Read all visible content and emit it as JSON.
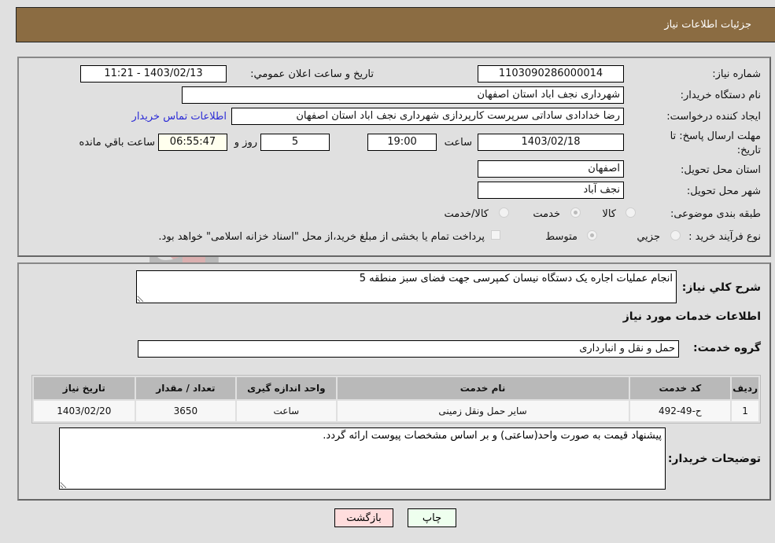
{
  "header": {
    "title": "جزئیات اطلاعات نیاز"
  },
  "form": {
    "need_number": {
      "label": "شماره نیاز:",
      "value": "1103090286000014"
    },
    "announce_datetime": {
      "label": "تاریخ و ساعت اعلان عمومي:",
      "value": "1403/02/13 - 11:21"
    },
    "buyer_org": {
      "label": "نام دستگاه خریدار:",
      "value": "شهرداری نجف اباد استان اصفهان"
    },
    "requester": {
      "label": "ایجاد کننده درخواست:",
      "value": "رضا خدادادی ساداتی سرپرست  کارپردازی شهرداری نجف اباد استان اصفهان"
    },
    "buyer_contact_link": "اطلاعات تماس خریدار",
    "deadline": {
      "label_line1": "مهلت ارسال پاسخ: تا",
      "label_line2": "تاریخ:",
      "date": "1403/02/18",
      "time_label": "ساعت",
      "time": "19:00",
      "days": "5",
      "days_label": "روز و",
      "remaining": "06:55:47",
      "remaining_label": "ساعت باقي مانده"
    },
    "delivery_province": {
      "label": "استان محل تحویل:",
      "value": "اصفهان"
    },
    "delivery_city": {
      "label": "شهر محل تحویل:",
      "value": "نجف آباد"
    },
    "category": {
      "label": "طبقه بندی موضوعی:",
      "options": [
        "کالا",
        "خدمت",
        "کالا/خدمت"
      ],
      "selected": "خدمت"
    },
    "purchase_process": {
      "label": "نوع فرآیند خرید :",
      "options": [
        "جزیي",
        "متوسط"
      ],
      "selected": "متوسط",
      "treasury_note": "پرداخت تمام یا بخشی از مبلغ خرید،از محل \"اسناد خزانه اسلامی\" خواهد بود.",
      "treasury_checked": false
    }
  },
  "details": {
    "summary_label": "شرح كلي نياز:",
    "summary_value": "انجام عملیات اجاره یک دستگاه نیسان کمپرسی جهت فضای سبز منطقه 5",
    "services_heading": "اطلاعات خدمات مورد نياز",
    "service_group_label": "گروه خدمت:",
    "service_group_value": "حمل و نقل و انبارداری",
    "table": {
      "headers": [
        "ردیف",
        "کد خدمت",
        "نام خدمت",
        "واحد اندازه گیری",
        "تعداد / مقدار",
        "تاریخ نیاز"
      ],
      "rows": [
        [
          "1",
          "ح-49-492",
          "سایر حمل ونقل زمینی",
          "ساعت",
          "3650",
          "1403/02/20"
        ]
      ]
    },
    "buyer_notes_label": "توضیحات خریدار:",
    "buyer_notes_value": "پیشنهاد قیمت به صورت واحد(ساعتی) و بر اساس مشخصات پیوست ارائه گردد."
  },
  "buttons": {
    "print": "چاپ",
    "back": "بازگشت"
  },
  "colors": {
    "header_bg": "#8b6c42",
    "print_bg": "#eeffee",
    "back_bg": "#ffdddd",
    "link": "#2b2bd6"
  }
}
